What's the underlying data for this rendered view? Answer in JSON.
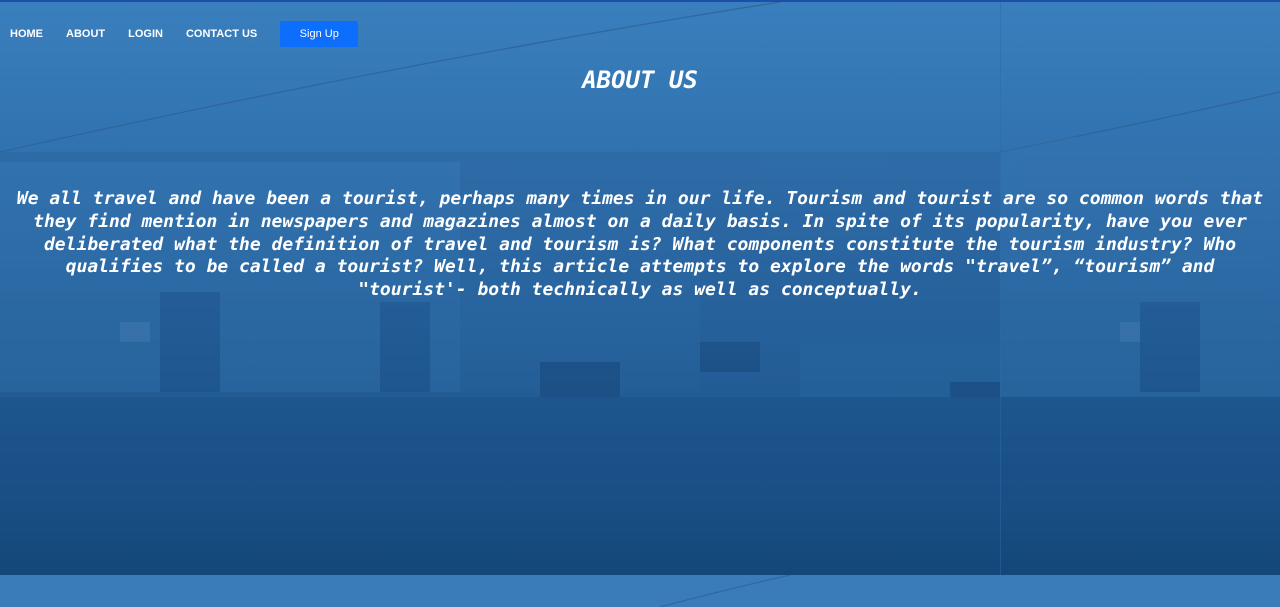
{
  "nav": {
    "links": [
      "HOME",
      "ABOUT",
      "LOGIN",
      "CONTACT US"
    ],
    "signup_label": "Sign Up",
    "signup_color": "#0d6efd"
  },
  "main": {
    "title": "ABOUT US",
    "body": "We all travel and have been a tourist, perhaps many times in our life. Tourism and tourist are so common words that they find mention in newspapers and magazines almost on a daily basis. In spite of its popularity, have you ever deliberated what the definition of travel and tourism is? What components constitute the tourism industry? Who qualifies to be called a tourist? Well, this article attempts to explore the words \"travel”, “tourism” and \"tourist'- both technically as well as conceptually."
  },
  "theme": {
    "overlay_top": "#3a7fbd",
    "overlay_bottom": "#134779"
  }
}
